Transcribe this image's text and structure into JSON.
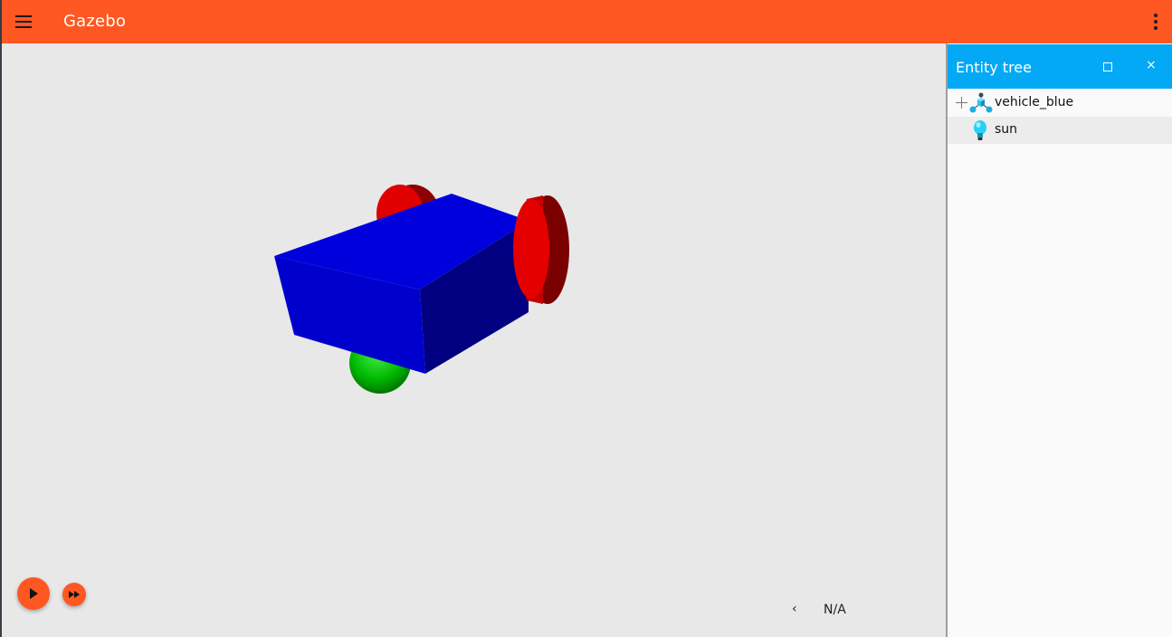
{
  "app": {
    "title": "Gazebo"
  },
  "theme": {
    "primary": "#ff5722",
    "accent": "#03a9f4",
    "scene_background": "#e8e8e8"
  },
  "icons": {
    "menu": "hamburger-menu-icon",
    "more": "vertical-dots-icon",
    "play": "play-icon",
    "step": "fast-forward-icon",
    "stats_toggle": "chevron-left-icon",
    "panel_maximize": "square-icon",
    "panel_close": "close-icon",
    "model": "model-icon",
    "light": "light-bulb-icon"
  },
  "scene": {
    "model_colors": {
      "chassis": "#0000cc",
      "wheels": "#dd0000",
      "caster": "#00bb00"
    }
  },
  "stats": {
    "toggle_label": "‹",
    "value": "N/A"
  },
  "entity_tree": {
    "title": "Entity tree",
    "maximize_label": "□",
    "close_label": "×",
    "items": [
      {
        "label": "vehicle_blue",
        "type": "model",
        "expandable": true
      },
      {
        "label": "sun",
        "type": "light",
        "expandable": false
      }
    ]
  }
}
